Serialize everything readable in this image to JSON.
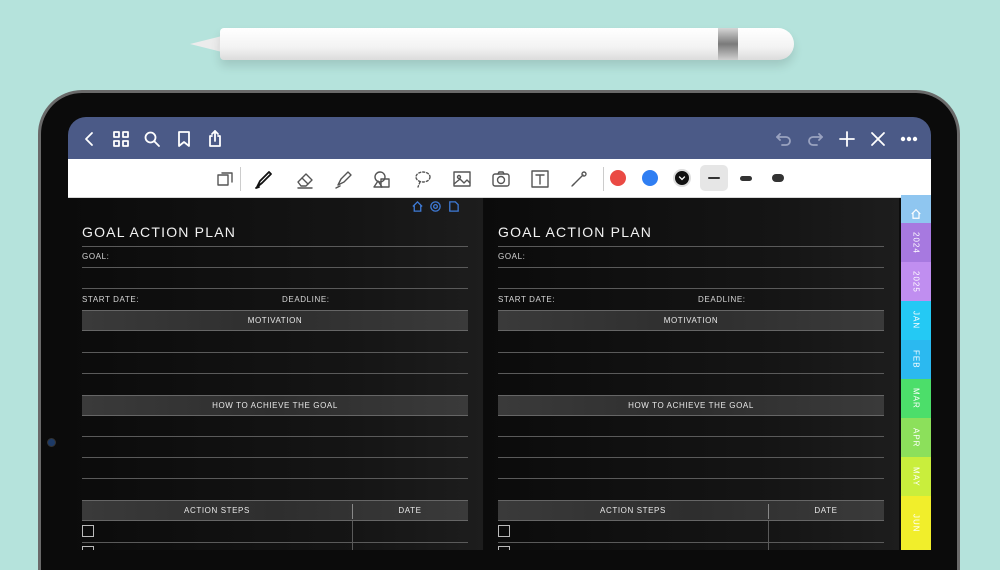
{
  "navbar": {
    "left_icons": [
      "back-icon",
      "grid-icon",
      "search-icon",
      "bookmark-icon",
      "share-icon"
    ],
    "right_icons": [
      "undo-icon",
      "redo-icon",
      "add-icon",
      "close-icon",
      "more-icon"
    ]
  },
  "toolbar": {
    "tools": [
      "page-view-icon",
      "pen-icon",
      "eraser-icon",
      "highlighter-icon",
      "shapes-icon",
      "lasso-icon",
      "image-icon",
      "camera-icon",
      "text-icon",
      "laser-pointer-icon"
    ],
    "colors": [
      "#ea4a44",
      "#2f7ef2",
      "#111111"
    ],
    "selected_color": "#111111",
    "thickness_options": [
      "thin",
      "medium",
      "thick"
    ],
    "selected_thickness": "thin"
  },
  "pages": [
    {
      "title": "GOAL ACTION PLAN",
      "goal_label": "GOAL:",
      "start_date_label": "START DATE:",
      "deadline_label": "DEADLINE:",
      "motivation_label": "MOTIVATION",
      "how_label": "HOW TO ACHIEVE THE GOAL",
      "action_steps_label": "ACTION STEPS",
      "date_label": "DATE"
    },
    {
      "title": "GOAL ACTION PLAN",
      "goal_label": "GOAL:",
      "start_date_label": "START DATE:",
      "deadline_label": "DEADLINE:",
      "motivation_label": "MOTIVATION",
      "how_label": "HOW TO ACHIEVE THE GOAL",
      "action_steps_label": "ACTION STEPS",
      "date_label": "DATE"
    }
  ],
  "side_tabs": [
    {
      "label": "",
      "icon": "home-icon",
      "color": "#8fc6f0"
    },
    {
      "label": "2024",
      "color": "#a779e0"
    },
    {
      "label": "2025",
      "color": "#c08ef0"
    },
    {
      "label": "JAN",
      "color": "#24c9f4"
    },
    {
      "label": "FEB",
      "color": "#2bb9f0"
    },
    {
      "label": "MAR",
      "color": "#4cde6a"
    },
    {
      "label": "APR",
      "color": "#8ce05b"
    },
    {
      "label": "MAY",
      "color": "#c9ee3c"
    },
    {
      "label": "JUN",
      "color": "#f1ee2b"
    }
  ]
}
